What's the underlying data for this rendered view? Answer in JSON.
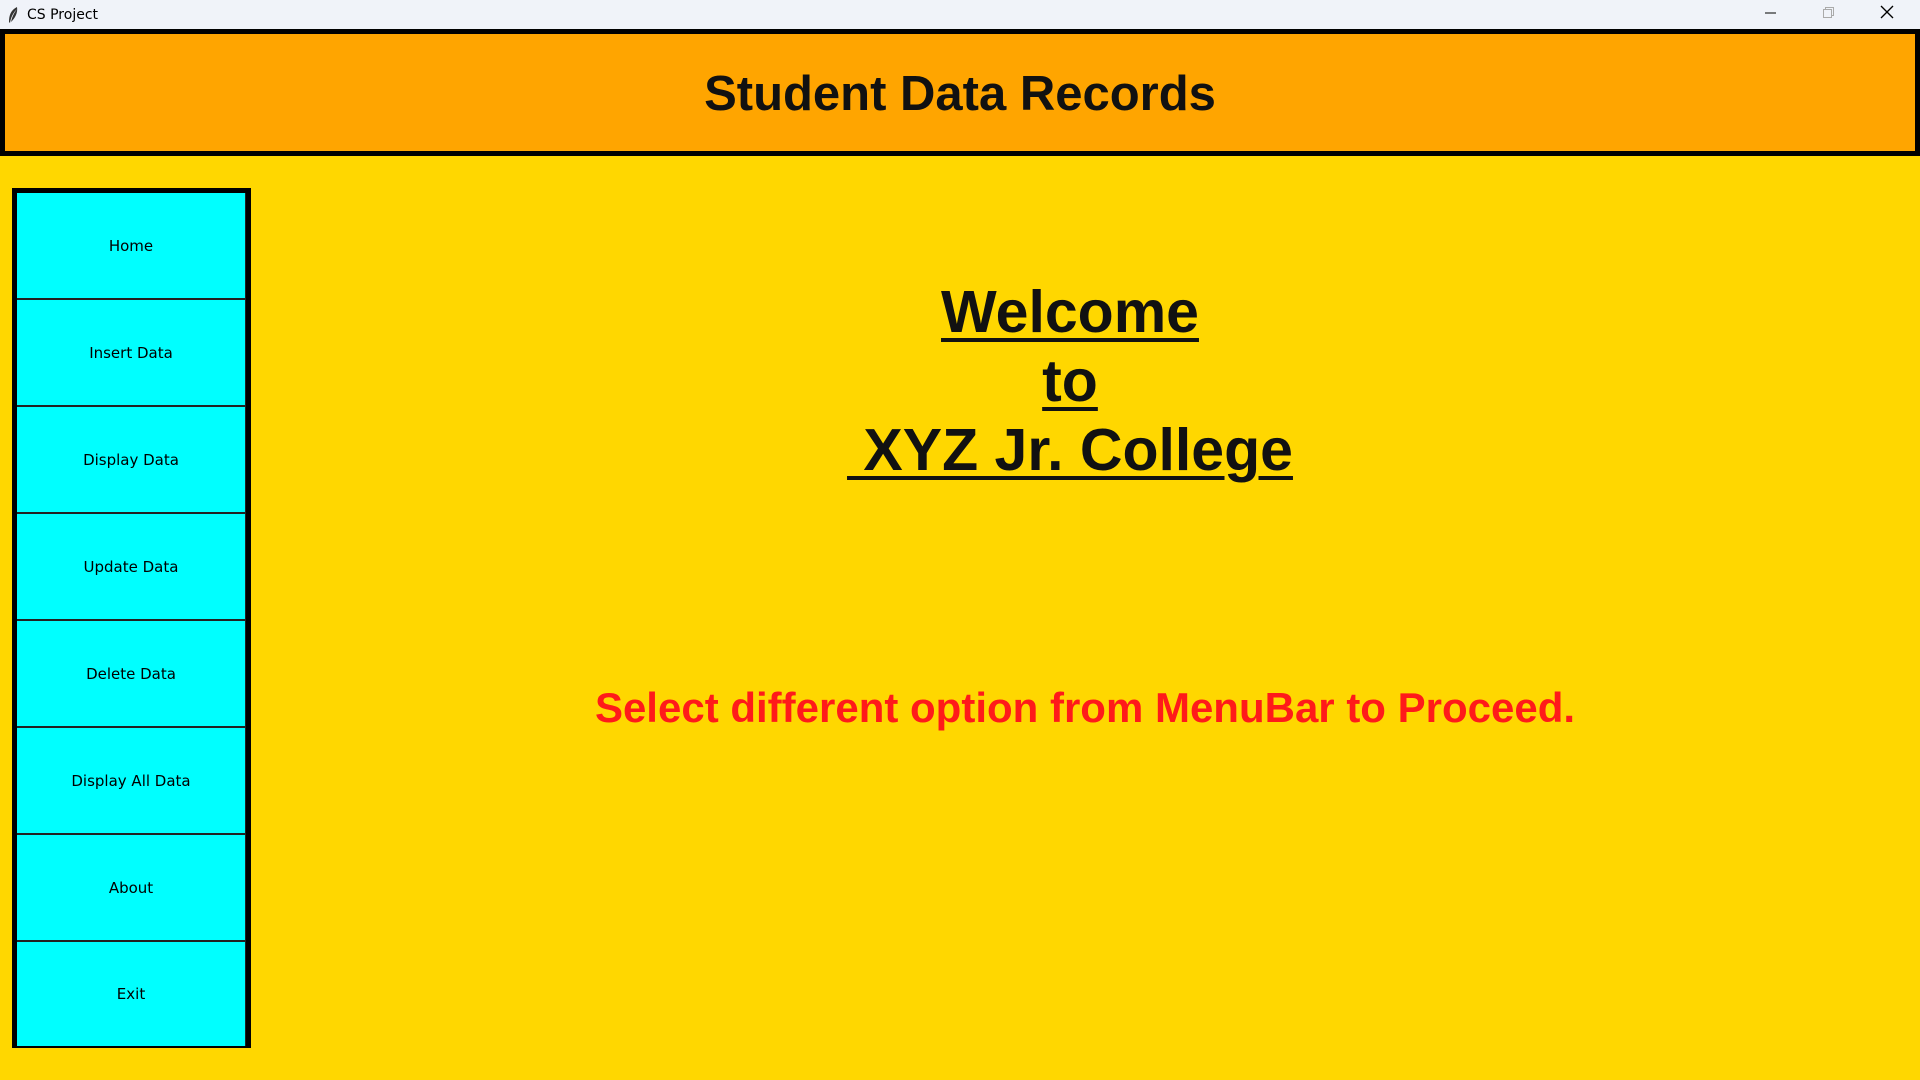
{
  "window": {
    "title": "CS Project",
    "icon": "feather-icon",
    "controls": [
      "minimize-icon",
      "maximize-icon",
      "close-icon"
    ]
  },
  "header": {
    "title": "Student Data Records"
  },
  "sidebar": {
    "items": [
      {
        "label": "Home"
      },
      {
        "label": "Insert Data"
      },
      {
        "label": "Display Data"
      },
      {
        "label": "Update Data"
      },
      {
        "label": "Delete Data"
      },
      {
        "label": "Display All Data"
      },
      {
        "label": "About"
      },
      {
        "label": "Exit"
      }
    ]
  },
  "main": {
    "welcome_lines": [
      "Welcome",
      "to",
      " XYZ Jr. College"
    ],
    "instruction": "Select different option from MenuBar to Proceed."
  },
  "colors": {
    "background": "#FFD700",
    "header": "#FFA500",
    "sidebar": "#00FFFF",
    "instruction_text": "#FF1A1A"
  }
}
